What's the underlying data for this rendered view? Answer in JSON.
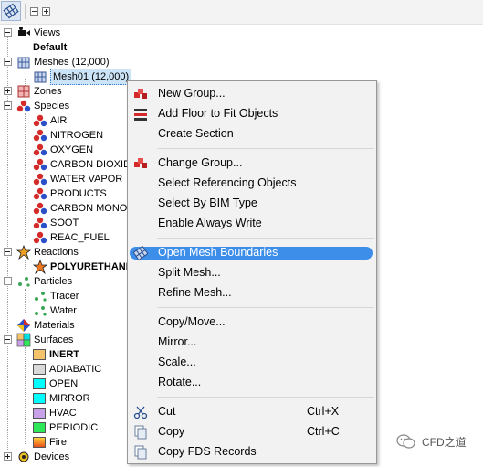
{
  "tree": {
    "views": "Views",
    "default": "Default",
    "meshes": "Meshes (12,000)",
    "mesh01": "Mesh01 (12,000)",
    "zones": "Zones",
    "species": "Species",
    "species_items": [
      "AIR",
      "NITROGEN",
      "OXYGEN",
      "CARBON DIOXIDE",
      "WATER VAPOR",
      "PRODUCTS",
      "CARBON MONOXIDE",
      "SOOT",
      "REAC_FUEL"
    ],
    "reactions": "Reactions",
    "polyurethane": "POLYURETHANE",
    "particles": "Particles",
    "tracer": "Tracer",
    "water": "Water",
    "materials": "Materials",
    "surfaces": "Surfaces",
    "surface_items": [
      {
        "label": "INERT",
        "color": "#f5c36b",
        "bold": true
      },
      {
        "label": "ADIABATIC",
        "color": "#d9d9d9",
        "bold": false
      },
      {
        "label": "OPEN",
        "color": "#00ffff",
        "bold": false
      },
      {
        "label": "MIRROR",
        "color": "#00ffff",
        "bold": false
      },
      {
        "label": "HVAC",
        "color": "#c8a2e8",
        "bold": false
      },
      {
        "label": "PERIODIC",
        "color": "#2ee85a",
        "bold": false
      },
      {
        "label": "Fire",
        "color": "fire",
        "bold": false
      }
    ],
    "devices": "Devices"
  },
  "menu": {
    "new_group": "New Group...",
    "add_floor": "Add Floor to Fit Objects",
    "create_section": "Create Section",
    "change_group": "Change Group...",
    "select_referencing": "Select Referencing Objects",
    "select_bim": "Select By BIM Type",
    "enable_write": "Enable Always Write",
    "open_mesh_boundaries": "Open Mesh Boundaries",
    "split_mesh": "Split Mesh...",
    "refine_mesh": "Refine Mesh...",
    "copy_move": "Copy/Move...",
    "mirror": "Mirror...",
    "scale": "Scale...",
    "rotate": "Rotate...",
    "cut": "Cut",
    "cut_shortcut": "Ctrl+X",
    "copy": "Copy",
    "copy_shortcut": "Ctrl+C",
    "copy_fds": "Copy FDS Records"
  },
  "watermark": "CFD之道",
  "colors": {
    "highlight": "#3d8ee8",
    "selected_bg": "#cce4f7",
    "species_red": "#d42a2a"
  }
}
